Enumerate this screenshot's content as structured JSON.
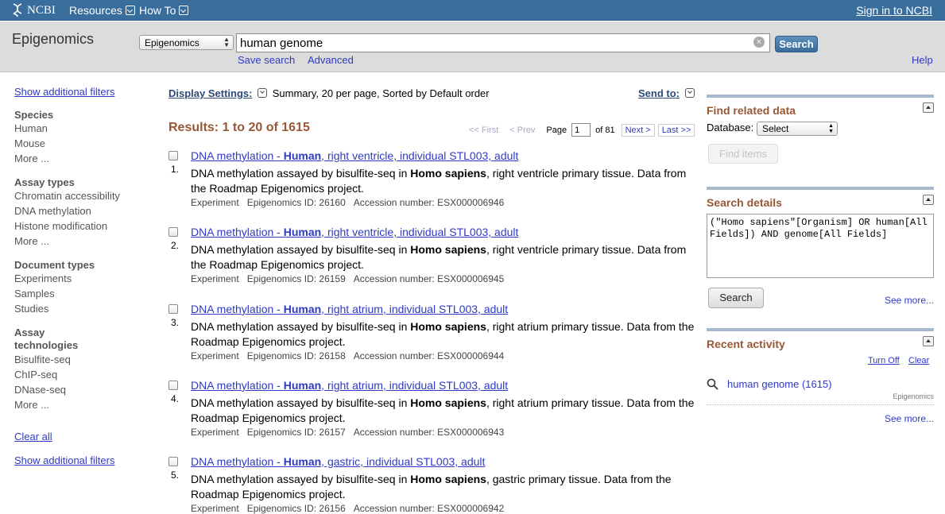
{
  "topbar": {
    "logo_text": "NCBI",
    "resources_label": "Resources",
    "howto_label": "How To",
    "signin_label": "Sign in to NCBI"
  },
  "search": {
    "db_title": "Epigenomics",
    "db_select_value": "Epigenomics",
    "term": "human genome",
    "search_button": "Search",
    "save_search": "Save search",
    "advanced": "Advanced",
    "help": "Help"
  },
  "filters": {
    "show_additional_top": "Show additional filters",
    "groups": [
      {
        "title": "Species",
        "items": [
          "Human",
          "Mouse",
          "More ..."
        ]
      },
      {
        "title": "Assay types",
        "items": [
          "Chromatin accessibility",
          "DNA methylation",
          "Histone modification",
          "More ..."
        ]
      },
      {
        "title": "Document types",
        "items": [
          "Experiments",
          "Samples",
          "Studies"
        ]
      },
      {
        "title": "Assay technologies",
        "items": [
          "Bisulfite-seq",
          "ChIP-seq",
          "DNase-seq",
          "More ..."
        ]
      }
    ],
    "clear_all": "Clear all",
    "show_additional_bottom": "Show additional filters"
  },
  "results": {
    "display_settings_label": "Display Settings:",
    "display_settings_value": "Summary, 20 per page, Sorted by Default order",
    "send_to": "Send to:",
    "count_label": "Results: 1 to 20 of 1615",
    "pager": {
      "first": "<< First",
      "prev": "< Prev",
      "page_label": "Page",
      "page_value": "1",
      "of_label": "of 81",
      "next": "Next >",
      "last": "Last >>"
    },
    "items": [
      {
        "num": "1.",
        "title_pre": "DNA methylation - ",
        "title_bold": "Human",
        "title_post": ", right ventricle, individual STL003, adult",
        "desc_pre": "DNA methylation assayed by bisulfite-seq in ",
        "desc_bold": "Homo sapiens",
        "desc_post": ", right ventricle primary tissue. Data from the Roadmap Epigenomics project.",
        "type": "Experiment",
        "eid": "Epigenomics ID: 26160",
        "acc": "Accession number: ESX000006946"
      },
      {
        "num": "2.",
        "title_pre": "DNA methylation - ",
        "title_bold": "Human",
        "title_post": ", right ventricle, individual STL003, adult",
        "desc_pre": "DNA methylation assayed by bisulfite-seq in ",
        "desc_bold": "Homo sapiens",
        "desc_post": ", right ventricle primary tissue. Data from the Roadmap Epigenomics project.",
        "type": "Experiment",
        "eid": "Epigenomics ID: 26159",
        "acc": "Accession number: ESX000006945"
      },
      {
        "num": "3.",
        "title_pre": "DNA methylation - ",
        "title_bold": "Human",
        "title_post": ", right atrium, individual STL003, adult",
        "desc_pre": "DNA methylation assayed by bisulfite-seq in ",
        "desc_bold": "Homo sapiens",
        "desc_post": ", right atrium primary tissue. Data from the Roadmap Epigenomics project.",
        "type": "Experiment",
        "eid": "Epigenomics ID: 26158",
        "acc": "Accession number: ESX000006944"
      },
      {
        "num": "4.",
        "title_pre": "DNA methylation - ",
        "title_bold": "Human",
        "title_post": ", right atrium, individual STL003, adult",
        "desc_pre": "DNA methylation assayed by bisulfite-seq in ",
        "desc_bold": "Homo sapiens",
        "desc_post": ", right atrium primary tissue. Data from the Roadmap Epigenomics project.",
        "type": "Experiment",
        "eid": "Epigenomics ID: 26157",
        "acc": "Accession number: ESX000006943"
      },
      {
        "num": "5.",
        "title_pre": "DNA methylation - ",
        "title_bold": "Human",
        "title_post": ", gastric, individual STL003, adult",
        "desc_pre": "DNA methylation assayed by bisulfite-seq in ",
        "desc_bold": "Homo sapiens",
        "desc_post": ", gastric primary tissue. Data from the Roadmap Epigenomics project.",
        "type": "Experiment",
        "eid": "Epigenomics ID: 26156",
        "acc": "Accession number: ESX000006942"
      }
    ]
  },
  "sidebar": {
    "related": {
      "title": "Find related data",
      "db_label": "Database:",
      "db_value": "Select",
      "find_button": "Find items"
    },
    "details": {
      "title": "Search details",
      "query": "(\"Homo sapiens\"[Organism] OR human[All Fields]) AND genome[All Fields]",
      "search_button": "Search",
      "see_more": "See more..."
    },
    "activity": {
      "title": "Recent activity",
      "turn_off": "Turn Off",
      "clear": "Clear",
      "item_text": "human genome (1615)",
      "item_db": "Epigenomics",
      "see_more": "See more..."
    }
  },
  "colors": {
    "topbar": "#396d9c",
    "link": "#2f3ac4",
    "heading_brown": "#985735",
    "header_grey": "#dcdcdc"
  }
}
